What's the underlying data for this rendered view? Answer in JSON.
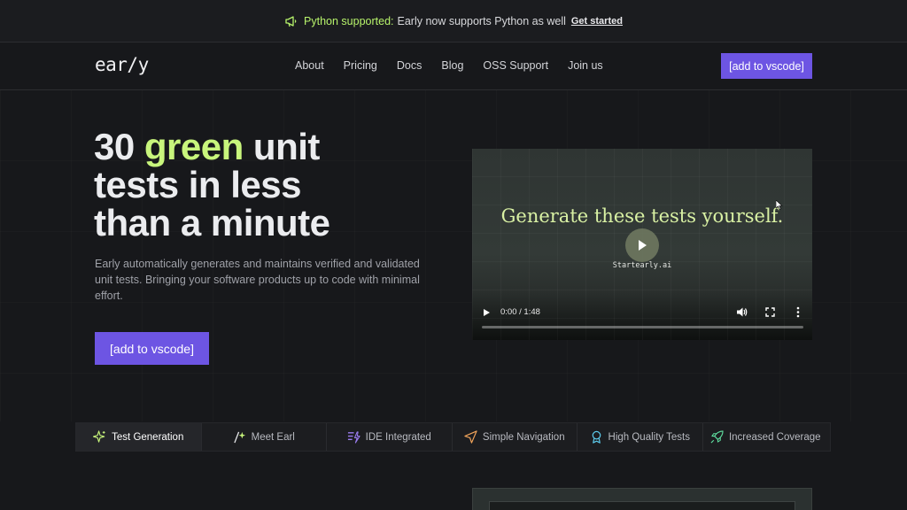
{
  "announcement": {
    "highlight": "Python supported:",
    "text": "Early now supports Python as well",
    "link": "Get started",
    "icon": "megaphone-icon"
  },
  "nav": {
    "logo": "ear/y",
    "links": [
      "About",
      "Pricing",
      "Docs",
      "Blog",
      "OSS Support",
      "Join us"
    ],
    "cta": "[add to vscode]"
  },
  "hero": {
    "headline_pre": "30 ",
    "headline_green": "green",
    "headline_post": " unit tests in less than a minute",
    "subtitle": "Early automatically generates and maintains verified and validated unit tests. Bringing your software products up to code with minimal effort.",
    "cta": "[add to vscode]"
  },
  "video": {
    "title": "Generate these tests yourself.",
    "brand": "Startearly.ai",
    "time": "0:00 / 1:48",
    "progress": 0
  },
  "tabs": [
    {
      "label": "Test Generation",
      "icon": "sparkles-icon",
      "color": "#c8f57c"
    },
    {
      "label": "Meet Earl",
      "icon": "wand-icon",
      "color": "#c8f57c"
    },
    {
      "label": "IDE Integrated",
      "icon": "list-lightning-icon",
      "color": "#9b7df0"
    },
    {
      "label": "Simple Navigation",
      "icon": "navigation-arrow-icon",
      "color": "#f0a35a"
    },
    {
      "label": "High Quality Tests",
      "icon": "award-ribbon-icon",
      "color": "#5cc8e8"
    },
    {
      "label": "Increased Coverage",
      "icon": "rocket-icon",
      "color": "#5fe0a0"
    }
  ],
  "colors": {
    "accent": "#6d55e3",
    "green": "#c8f57c",
    "background": "#17181b"
  }
}
